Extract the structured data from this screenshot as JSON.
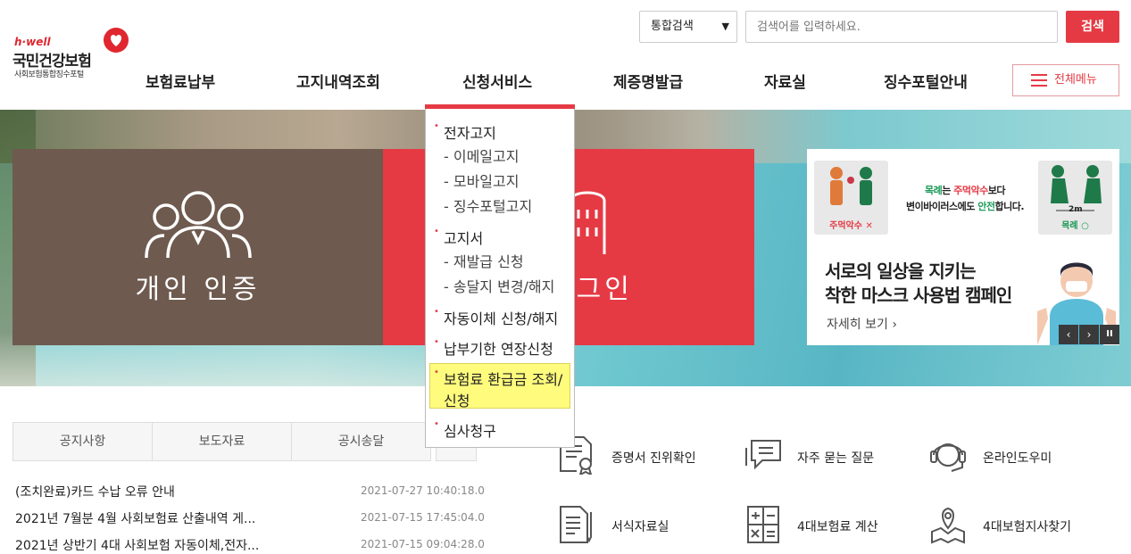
{
  "logo": {
    "hwell": "h·well",
    "name": "국민건강보험",
    "sub": "사회보험통합징수포털"
  },
  "search": {
    "select_value": "통합검색",
    "placeholder": "검색어를 입력하세요.",
    "button": "검색"
  },
  "gnb": [
    "보험료납부",
    "고지내역조회",
    "신청서비스",
    "제증명발급",
    "자료실",
    "징수포털안내"
  ],
  "all_menu": "전체메뉴",
  "dropdown": {
    "groups": [
      {
        "label": "전자고지",
        "subs": [
          "- 이메일고지",
          "- 모바일고지",
          "- 징수포털고지"
        ]
      },
      {
        "label": "고지서",
        "subs": [
          "- 재발급 신청",
          "- 송달지 변경/해지"
        ]
      },
      {
        "label": "자동이체 신청/해지",
        "subs": []
      },
      {
        "label": "납부기한 연장신청",
        "subs": []
      },
      {
        "label": "보험료 환급금 조회/",
        "label2": "신청",
        "subs": []
      },
      {
        "label": "심사청구",
        "subs": []
      }
    ]
  },
  "hero": {
    "personal_label": "개인 인증",
    "login_label": "로그인"
  },
  "banner": {
    "fig1_caption": "주먹악수 ✕",
    "fig2_caption": "목례 ○",
    "fig2_distance": "2m",
    "slogan_a": "목례",
    "slogan_b": "는 ",
    "slogan_c": "주먹악수",
    "slogan_d": "보다",
    "slogan_e": "변이바이러스에도 ",
    "slogan_f": "안전",
    "slogan_g": "합니다.",
    "title_line1": "서로의 일상을 지키는",
    "title_line2": "착한 마스크 사용법 캠페인",
    "more": "자세히 보기",
    "prev": "‹",
    "next": "›",
    "pause": "II"
  },
  "tabs": [
    "공지사항",
    "보도자료",
    "공시송달"
  ],
  "notices": [
    {
      "title": "(조치완료)카드 수납 오류 안내",
      "date": "2021-07-27 10:40:18.0"
    },
    {
      "title": "2021년 7월분 4월 사회보험료 산출내역 게...",
      "date": "2021-07-15 17:45:04.0"
    },
    {
      "title": "2021년 상반기 4대 사회보험 자동이체,전자...",
      "date": "2021-07-15 09:04:28.0"
    }
  ],
  "quick": [
    "증명서 진위확인",
    "자주 묻는 질문",
    "온라인도우미",
    "서식자료실",
    "4대보험료 계산",
    "4대보험지사찾기"
  ],
  "colors": {
    "accent": "#e53a44",
    "personal_card": "#6e5a4f",
    "highlight": "#fffb7d"
  }
}
